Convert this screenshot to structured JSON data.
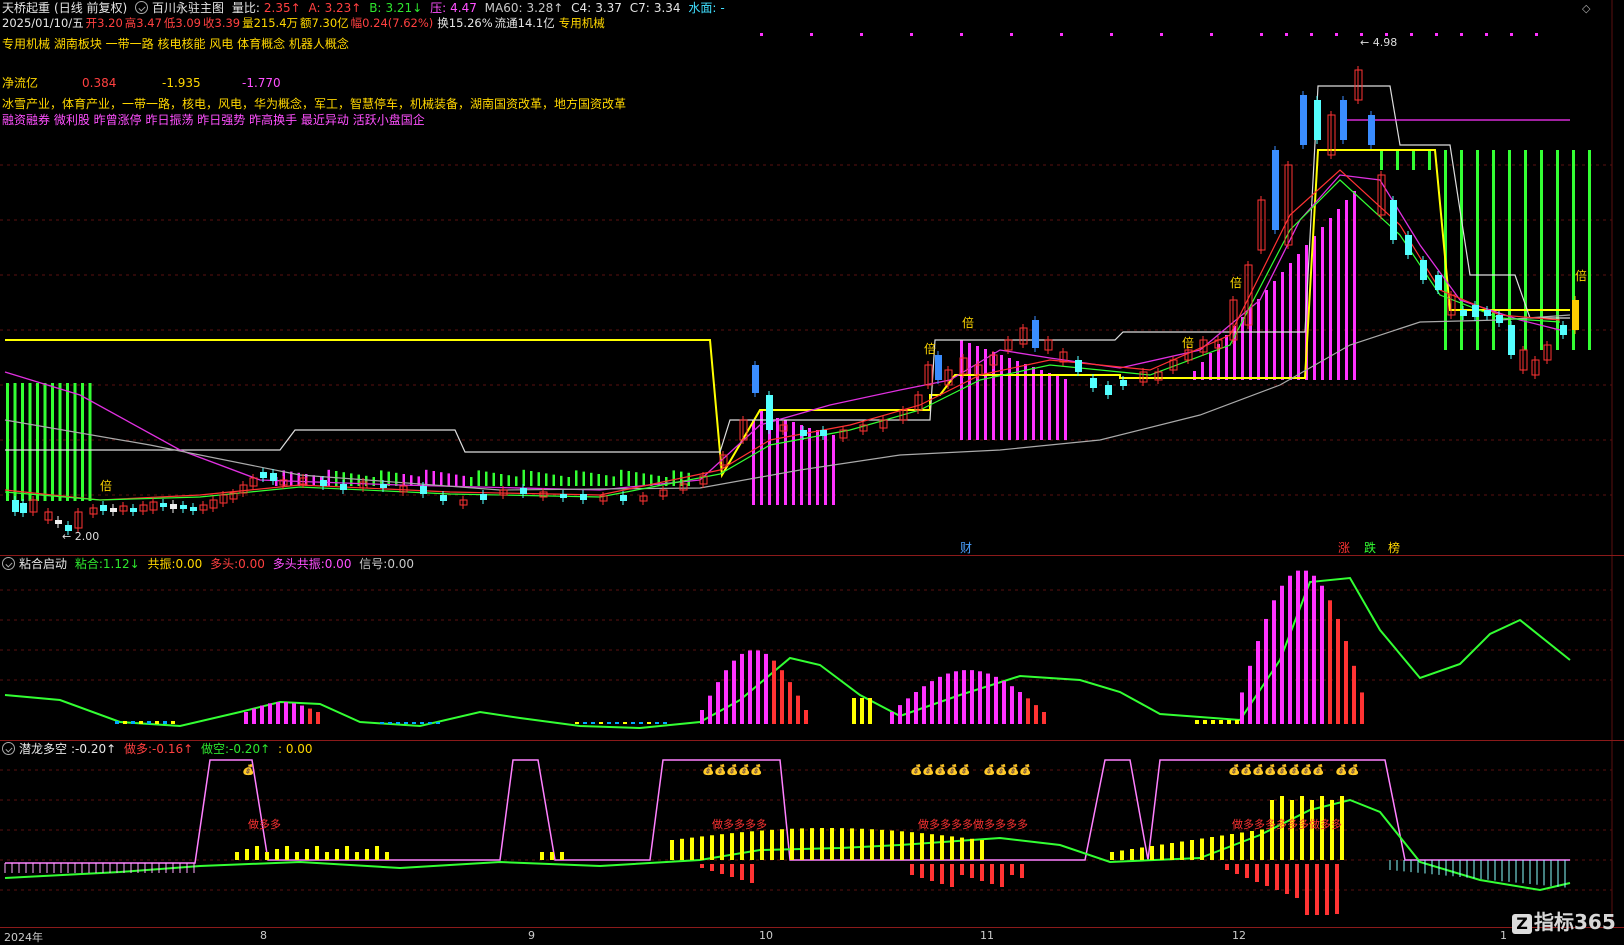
{
  "header": {
    "stock_name": "天桥起重",
    "period": "(日线 前复权)",
    "indicator": "百川永驻主图",
    "items": [
      {
        "label": "量比:",
        "value": "2.35↑",
        "color": "red"
      },
      {
        "label": "A:",
        "value": "3.23↑",
        "color": "red"
      },
      {
        "label": "B:",
        "value": "3.21↓",
        "color": "green"
      },
      {
        "label": "压:",
        "value": "4.47",
        "color": "mag"
      },
      {
        "label": "MA60:",
        "value": "3.28↑",
        "color": "grey"
      },
      {
        "label": "C4:",
        "value": "3.37",
        "color": "white"
      },
      {
        "label": "C7:",
        "value": "3.34",
        "color": "white"
      },
      {
        "label": "水面:",
        "value": "-",
        "color": "cyan"
      }
    ]
  },
  "quote": {
    "date": "2025/01/10/五",
    "open_label": "开",
    "open": "3.20",
    "high_label": "高",
    "high": "3.47",
    "low_label": "低",
    "low": "3.09",
    "close_label": "收",
    "close": "3.39",
    "vol_label": "量",
    "vol": "215.4万",
    "amount_label": "额",
    "amount": "7.30亿",
    "change_label": "幅",
    "change": "0.24(7.62%)",
    "turnover_label": "换",
    "turnover": "15.26%",
    "float_label": "流通",
    "float": "14.1亿",
    "sector": "专用机械"
  },
  "concepts_line": "专用机械 湖南板块 一带一路 核电核能 风电 体育概念 机器人概念",
  "netflow": {
    "label": "净流亿",
    "v1": "0.384",
    "v2": "-1.935",
    "v3": "-1.770"
  },
  "concepts_long": "冰雪产业，体育产业，一带一路，核电，风电，华为概念，军工，智慧停车，机械装备，湖南国资改革，地方国资改革",
  "tags_line": "融资融券 微利股 昨曾涨停 昨日振荡 昨日强势 昨高换手 最近异动 活跃小盘国企",
  "main_chart": {
    "annot_high": "4.98",
    "annot_low": "2.00",
    "bei_label": "倍",
    "bottom_tags": {
      "cai": "财",
      "zhang": "涨",
      "die": "跌",
      "bang": "榜"
    }
  },
  "panel2": {
    "title": "粘合启动",
    "items": [
      {
        "label": "粘合:",
        "value": "1.12↓",
        "color": "green"
      },
      {
        "label": "共振:",
        "value": "0.00",
        "color": "yellow"
      },
      {
        "label": "多头:",
        "value": "0.00",
        "color": "red"
      },
      {
        "label": "多头共振:",
        "value": "0.00",
        "color": "mag"
      },
      {
        "label": "信号:",
        "value": "0.00",
        "color": "grey"
      }
    ]
  },
  "panel3": {
    "title": "潜龙多空",
    "title_value": ":-0.20↑",
    "items": [
      {
        "label": "做多:",
        "value": "-0.16↑",
        "color": "red"
      },
      {
        "label": "做空:",
        "value": "-0.20↑",
        "color": "green"
      },
      {
        "label": "",
        "value": ": 0.00",
        "color": "yellow"
      }
    ],
    "label_a": "做多多",
    "label_b": "做多多多多",
    "label_c": "做多多多多做多多多多",
    "label_d": "做多多多多多多做多多",
    "money": "💰"
  },
  "x_axis": {
    "labels": [
      "2024年",
      "8",
      "9",
      "10",
      "11",
      "12",
      "1"
    ]
  },
  "watermark": "指标365",
  "colors": {
    "bg": "#000000",
    "red": "#ff3333",
    "cyan": "#54ffff",
    "magenta": "#ff33ff",
    "green": "#33ff33",
    "yellow": "#ffff00",
    "grey": "#888888"
  }
}
